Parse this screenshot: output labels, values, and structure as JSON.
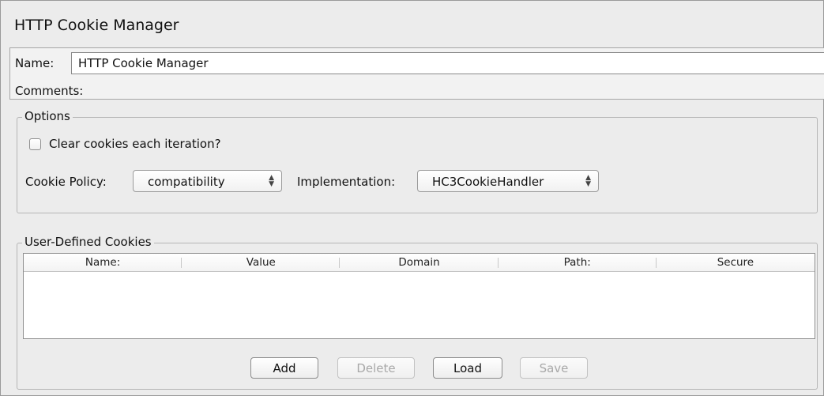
{
  "title": "HTTP Cookie Manager",
  "name_field": {
    "label": "Name:",
    "value": "HTTP Cookie Manager"
  },
  "comments_field": {
    "label": "Comments:",
    "value": ""
  },
  "options": {
    "legend": "Options",
    "clear_cookies_label": "Clear cookies each iteration?",
    "clear_cookies_checked": false,
    "cookie_policy_label": "Cookie Policy:",
    "cookie_policy_value": "compatibility",
    "implementation_label": "Implementation:",
    "implementation_value": "HC3CookieHandler"
  },
  "user_defined_cookies": {
    "legend": "User-Defined Cookies",
    "columns": [
      "Name:",
      "Value",
      "Domain",
      "Path:",
      "Secure"
    ],
    "rows": []
  },
  "buttons": {
    "add": "Add",
    "delete": "Delete",
    "load": "Load",
    "save": "Save"
  },
  "icons": {
    "select_arrows": "up-down-chevron-icon"
  }
}
